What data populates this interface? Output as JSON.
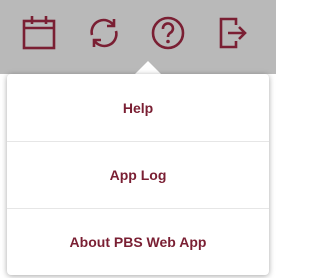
{
  "colors": {
    "toolbar_bg": "#b9b9b9",
    "accent": "#7a1f33",
    "menu_bg": "#ffffff",
    "divider": "#e6e6e6"
  },
  "toolbar": {
    "icons": [
      {
        "name": "calendar-icon"
      },
      {
        "name": "sync-icon"
      },
      {
        "name": "help-circle-icon"
      },
      {
        "name": "exit-icon"
      }
    ]
  },
  "menu": {
    "items": [
      {
        "label": "Help"
      },
      {
        "label": "App Log"
      },
      {
        "label": "About PBS Web App"
      }
    ]
  }
}
